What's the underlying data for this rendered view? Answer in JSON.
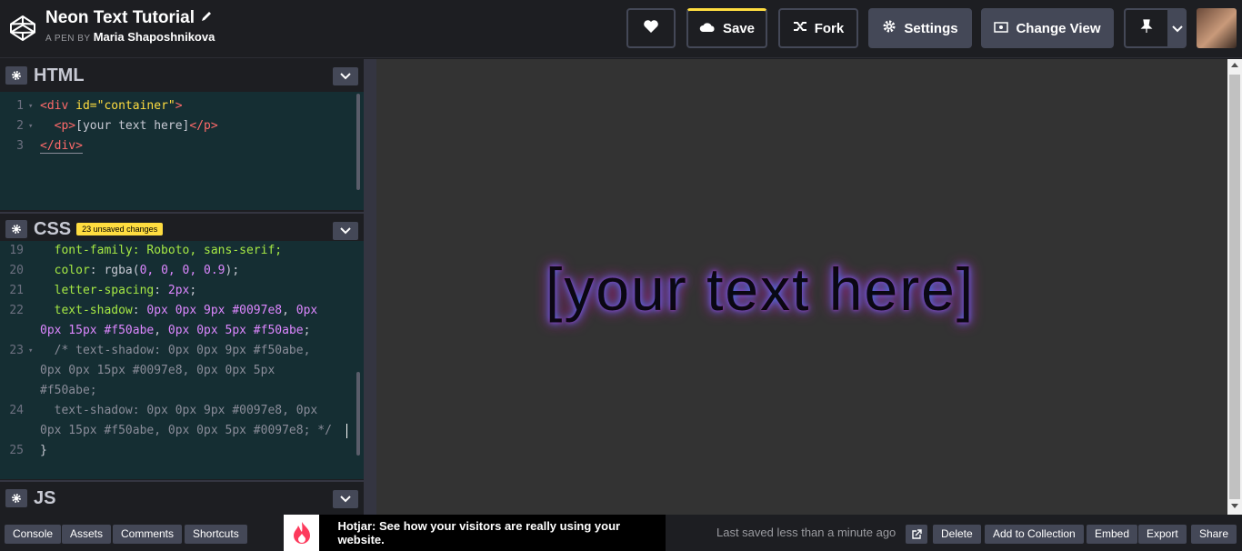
{
  "header": {
    "title": "Neon Text Tutorial",
    "byline_prefix": "A PEN BY",
    "author": "Maria Shaposhnikova",
    "buttons": {
      "save": "Save",
      "fork": "Fork",
      "settings": "Settings",
      "change_view": "Change View"
    }
  },
  "panes": {
    "html": {
      "title": "HTML",
      "lines": [
        {
          "n": "1",
          "fold": "▾"
        },
        {
          "n": "2",
          "fold": "▾"
        },
        {
          "n": "3",
          "fold": ""
        }
      ],
      "code": {
        "l1_a": "<div ",
        "l1_b": "id=",
        "l1_c": "\"container\"",
        "l1_d": ">",
        "l2_a": "  <p>",
        "l2_b": "[your text here]",
        "l2_c": "</p>",
        "l3_a": "</div>"
      }
    },
    "css": {
      "title": "CSS",
      "badge": "23 unsaved changes",
      "line_numbers": [
        "19",
        "20",
        "21",
        "22",
        "",
        "23",
        "",
        "",
        "24",
        "",
        "25"
      ],
      "code": {
        "l19_a": "  font-family",
        "l19_b": ": Roboto, sans-serif;",
        "l20_a": "  color",
        "l20_b": ": rgba(",
        "l20_c": "0, 0, 0, 0.9",
        "l20_d": ");",
        "l21_a": "  letter-spacing",
        "l21_b": ": ",
        "l21_c": "2px",
        "l21_d": ";",
        "l22_a": "  text-shadow",
        "l22_b": ": ",
        "l22_c": "0px 0px 9px #0097e8",
        "l22_d": ", ",
        "l22_e": "0px",
        "l22w": "0px 15px #f50abe",
        "l22w_b": ", ",
        "l22w_c": "0px 0px 5px #f50abe",
        "l22w_d": ";",
        "l23": "  /* text-shadow: 0px 0px 9px #f50abe,",
        "l23w1": "0px 0px 15px #0097e8, 0px 0px 5px",
        "l23w2": "#f50abe;",
        "l24": "  text-shadow: 0px 0px 9px #0097e8, 0px",
        "l24w": "0px 15px #f50abe, 0px 0px 5px #0097e8; */",
        "l25": "}"
      }
    },
    "js": {
      "title": "JS"
    }
  },
  "preview": {
    "text": "[your text here]"
  },
  "footer": {
    "buttons": [
      "Console",
      "Assets",
      "Comments",
      "Shortcuts"
    ],
    "ad_text": "Hotjar: See how your visitors are really using your website.",
    "saved_status": "Last saved less than a minute ago",
    "actions": [
      "Delete",
      "Add to Collection",
      "Embed",
      "Export",
      "Share"
    ]
  },
  "colors": {
    "accent": "#ffdd40",
    "neon_blue": "#0097e8",
    "neon_pink": "#f50abe"
  }
}
